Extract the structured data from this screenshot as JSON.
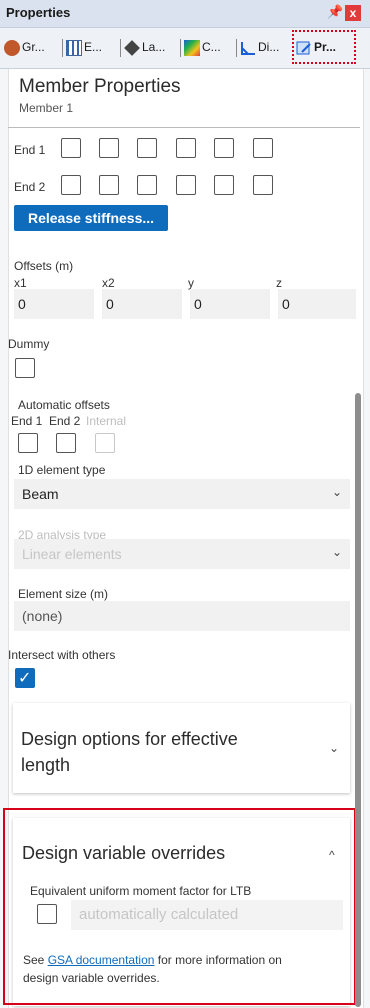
{
  "window": {
    "title": "Properties",
    "pin_glyph": "ᵩ",
    "close_glyph": "x"
  },
  "tabs": [
    {
      "label": "Gr...",
      "icon": "gear-icon"
    },
    {
      "label": "E...",
      "icon": "grid-icon"
    },
    {
      "label": "La...",
      "icon": "tag-icon"
    },
    {
      "label": "C...",
      "icon": "palette-icon"
    },
    {
      "label": "Di...",
      "icon": "diagram-icon"
    },
    {
      "label": "Pr...",
      "icon": "properties-icon"
    }
  ],
  "header": {
    "title": "Member Properties",
    "subtitle": "Member 1"
  },
  "releases": {
    "end1_label": "End 1",
    "end2_label": "End 2",
    "button_label": "Release stiffness..."
  },
  "offsets": {
    "label": "Offsets (m)",
    "fields": [
      {
        "label": "x1",
        "value": "0"
      },
      {
        "label": "x2",
        "value": "0"
      },
      {
        "label": "y",
        "value": "0"
      },
      {
        "label": "z",
        "value": "0"
      }
    ]
  },
  "dummy": {
    "label": "Dummy"
  },
  "automatic_offsets": {
    "label": "Automatic offsets",
    "end1": "End 1",
    "end2": "End 2",
    "internal": "Internal"
  },
  "element_type": {
    "label": "1D element type",
    "value": "Beam"
  },
  "analysis_type": {
    "label": "2D analysis type",
    "value": "Linear elements"
  },
  "element_size": {
    "label": "Element size (m)",
    "value": "(none)"
  },
  "intersect": {
    "label": "Intersect with others",
    "checked": true
  },
  "design_options": {
    "title": "Design options for effective length",
    "line1": "Design options for effective",
    "line2": "length",
    "chevron": "⌄"
  },
  "design_overrides": {
    "title": "Design variable overrides",
    "chevron": "^",
    "moment_label": "Equivalent uniform moment factor for LTB",
    "moment_value": "automatically calculated",
    "see": "See ",
    "link": "GSA documentation",
    "rest1": " for more information on",
    "rest2": "design variable overrides."
  }
}
